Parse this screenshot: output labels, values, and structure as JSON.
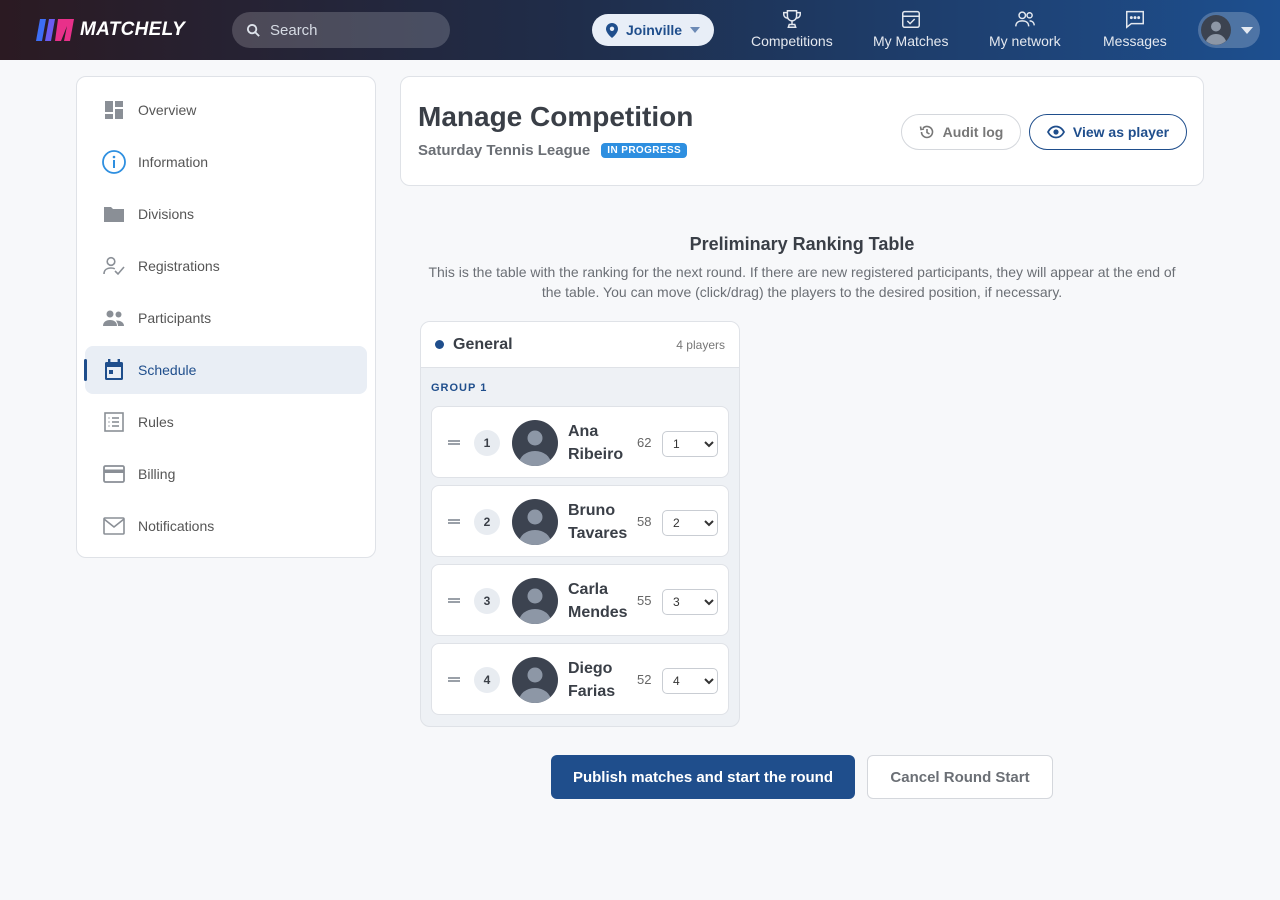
{
  "app": {
    "brand": "MATCHELY",
    "search_placeholder": "Search",
    "city": "Joinville",
    "colors": {
      "primary": "#1f4e8c",
      "badge": "#2e8fe0",
      "logo_blue": "#3d6ef5",
      "logo_pink": "#e8308a"
    }
  },
  "nav": {
    "items": [
      {
        "label": "Competitions",
        "icon": "trophy-icon"
      },
      {
        "label": "My Matches",
        "icon": "calendar-check-icon"
      },
      {
        "label": "My network",
        "icon": "people-icon"
      },
      {
        "label": "Messages",
        "icon": "chat-icon"
      }
    ]
  },
  "sidebar": {
    "active": "Schedule",
    "items": [
      {
        "label": "Overview",
        "icon": "dashboard-icon"
      },
      {
        "label": "Information",
        "icon": "info-icon"
      },
      {
        "label": "Divisions",
        "icon": "folder-icon"
      },
      {
        "label": "Registrations",
        "icon": "person-check-icon"
      },
      {
        "label": "Participants",
        "icon": "people-icon"
      },
      {
        "label": "Schedule",
        "icon": "calendar-icon"
      },
      {
        "label": "Rules",
        "icon": "list-icon"
      },
      {
        "label": "Billing",
        "icon": "credit-card-icon"
      },
      {
        "label": "Notifications",
        "icon": "mail-icon"
      }
    ]
  },
  "header": {
    "title": "Manage Competition",
    "competition_name": "Saturday Tennis League",
    "status": "IN PROGRESS",
    "audit_label": "Audit log",
    "view_label": "View as player"
  },
  "ranking": {
    "title": "Preliminary Ranking Table",
    "description": "This is the table with the ranking for the next round. If there are new registered participants, they will appear at the end of the table. You can move (click/drag) the players to the desired position, if necessary.",
    "division": {
      "name": "General",
      "count_label": "4 players",
      "group_label": "GROUP 1",
      "players": [
        {
          "position": "1",
          "first": "Ana",
          "last": "Ribeiro",
          "points": "62",
          "selected": "1"
        },
        {
          "position": "2",
          "first": "Bruno",
          "last": "Tavares",
          "points": "58",
          "selected": "2"
        },
        {
          "position": "3",
          "first": "Carla",
          "last": "Mendes",
          "points": "55",
          "selected": "3"
        },
        {
          "position": "4",
          "first": "Diego",
          "last": "Farias",
          "points": "52",
          "selected": "4"
        }
      ],
      "position_options": [
        "1",
        "2",
        "3",
        "4"
      ]
    }
  },
  "actions": {
    "publish_label": "Publish matches and start the round",
    "cancel_label": "Cancel Round Start"
  }
}
